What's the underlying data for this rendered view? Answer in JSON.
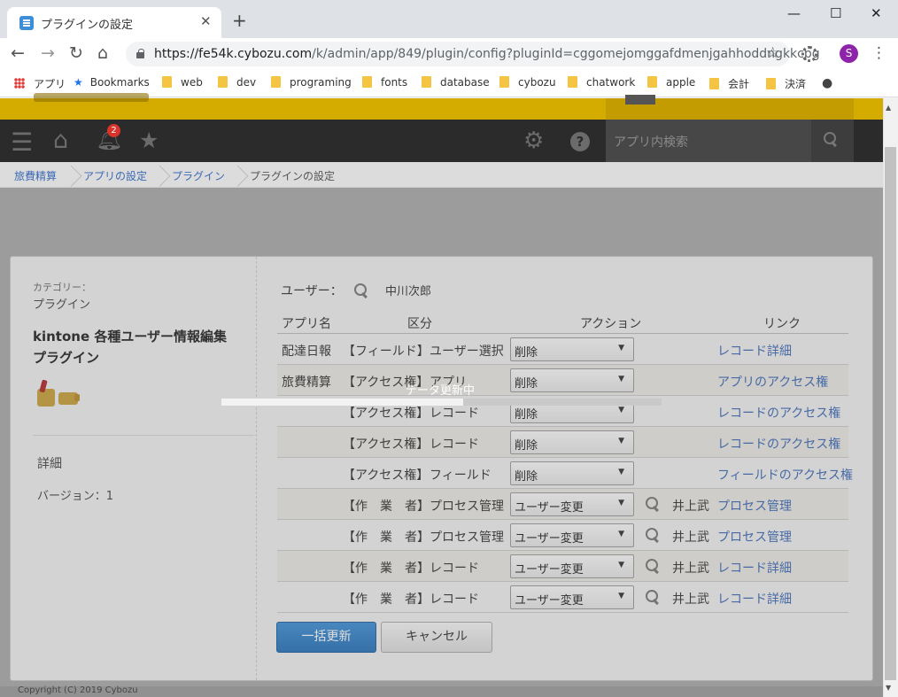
{
  "browser": {
    "tab_title": "プラグインの設定",
    "url_host": "https://fe54k.cybozu.com",
    "url_path": "/k/admin/app/849/plugin/config?pluginId=cggomejomggafdmenjgahhoddngkkcpg",
    "avatar_letter": "S",
    "bookmarks": [
      "アプリ",
      "Bookmarks",
      "web",
      "dev",
      "programing",
      "fonts",
      "database",
      "cybozu",
      "chatwork",
      "apple",
      "会計",
      "決済"
    ]
  },
  "kintone": {
    "notification_count": "2",
    "search_placeholder": "アプリ内検索",
    "breadcrumb": [
      "旅費精算",
      "アプリの設定",
      "プラグイン",
      "プラグインの設定"
    ]
  },
  "plugin": {
    "category_label": "カテゴリー：",
    "category_value": "プラグイン",
    "name_line1": "kintone 各種ユーザー情報編集",
    "name_line2": "プラグイン",
    "details_label": "詳細",
    "version": "バージョン：1"
  },
  "user": {
    "label": "ユーザー：",
    "name": "中川次郎"
  },
  "table": {
    "headers": [
      "アプリ名",
      "区分",
      "アクション",
      "リンク"
    ],
    "rows": [
      {
        "app": "配達日報",
        "type": "【フィールド】",
        "target": "ユーザー選択",
        "action": "削除",
        "person": "",
        "link": "レコード詳細"
      },
      {
        "app": "旅費精算",
        "type": "【アクセス権】",
        "target": "アプリ",
        "action": "削除",
        "person": "",
        "link": "アプリのアクセス権"
      },
      {
        "app": "",
        "type": "【アクセス権】",
        "target": "レコード",
        "action": "削除",
        "person": "",
        "link": "レコードのアクセス権"
      },
      {
        "app": "",
        "type": "【アクセス権】",
        "target": "レコード",
        "action": "削除",
        "person": "",
        "link": "レコードのアクセス権"
      },
      {
        "app": "",
        "type": "【アクセス権】",
        "target": "フィールド",
        "action": "削除",
        "person": "",
        "link": "フィールドのアクセス権"
      },
      {
        "app": "",
        "type": "【作　業　者】",
        "target": "プロセス管理",
        "action": "ユーザー変更",
        "person": "井上武",
        "link": "プロセス管理"
      },
      {
        "app": "",
        "type": "【作　業　者】",
        "target": "プロセス管理",
        "action": "ユーザー変更",
        "person": "井上武",
        "link": "プロセス管理"
      },
      {
        "app": "",
        "type": "【作　業　者】",
        "target": "レコード",
        "action": "ユーザー変更",
        "person": "井上武",
        "link": "レコード詳細"
      },
      {
        "app": "",
        "type": "【作　業　者】",
        "target": "レコード",
        "action": "ユーザー変更",
        "person": "井上武",
        "link": "レコード詳細"
      }
    ]
  },
  "buttons": {
    "update": "一括更新",
    "cancel": "キャンセル"
  },
  "progress": {
    "label": "データ更新中",
    "fraction": 0.55
  },
  "footer": "Copyright (C) 2019 Cybozu",
  "colors": {
    "accent_yellow": "#d4ac00",
    "link_blue": "#3d6ab5",
    "primary_button": "#2672b8"
  }
}
